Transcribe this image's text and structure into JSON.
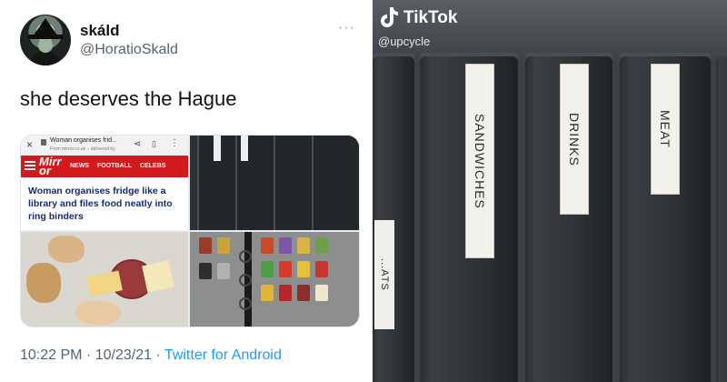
{
  "tweet": {
    "display_name": "skáld",
    "handle": "@HoratioSkald",
    "more_icon": "more-dots-icon",
    "text": "she deserves the Hague",
    "meta": {
      "time": "10:22 PM",
      "separator1": " · ",
      "date": "10/23/21",
      "separator2": " · ",
      "source": "Twitter for Android"
    },
    "media": {
      "article": {
        "browser_title": "Woman organises frid...",
        "browser_subtitle": "From mirror.co.uk – delivered by",
        "logo": "Mirr\nor",
        "nav": [
          "NEWS",
          "FOOTBALL",
          "CELEBS"
        ],
        "headline": "Woman organises fridge like a library and files food neatly into ring binders"
      }
    }
  },
  "tiktok": {
    "app_name": "TikTok",
    "username": "@upcycle",
    "spine_labels": [
      "SANDWICHES",
      "DRINKS",
      "MEAT"
    ],
    "partial_label": "...ATS"
  },
  "colors": {
    "link_blue": "#1d9bf0",
    "mirror_red": "#d11a1e",
    "binder_black": "#2f3235"
  }
}
